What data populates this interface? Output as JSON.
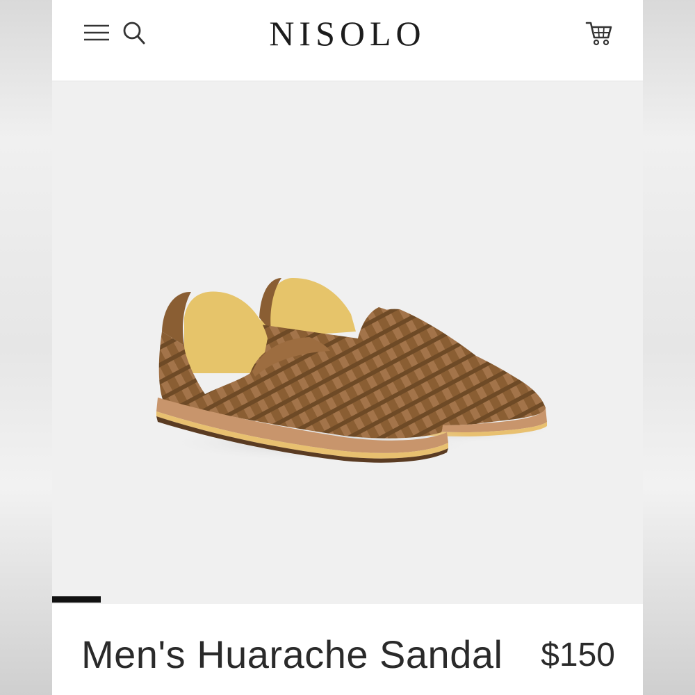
{
  "header": {
    "brand": "NISOLO",
    "icons": {
      "menu": "hamburger-menu-icon",
      "search": "search-icon",
      "cart": "shopping-cart-icon"
    }
  },
  "hero": {
    "image_subject": "pair of woven brown suede huarache sandals",
    "carousel": {
      "current_slide": 1
    }
  },
  "product": {
    "title": "Men's Huarache Sandal",
    "price": "$150"
  },
  "colors": {
    "background": "#f0f0f0",
    "header": "#ffffff",
    "text": "#2a2a2a",
    "leather": "#9a6a3d",
    "lining": "#e6c46a",
    "sole": "#c8956c"
  }
}
